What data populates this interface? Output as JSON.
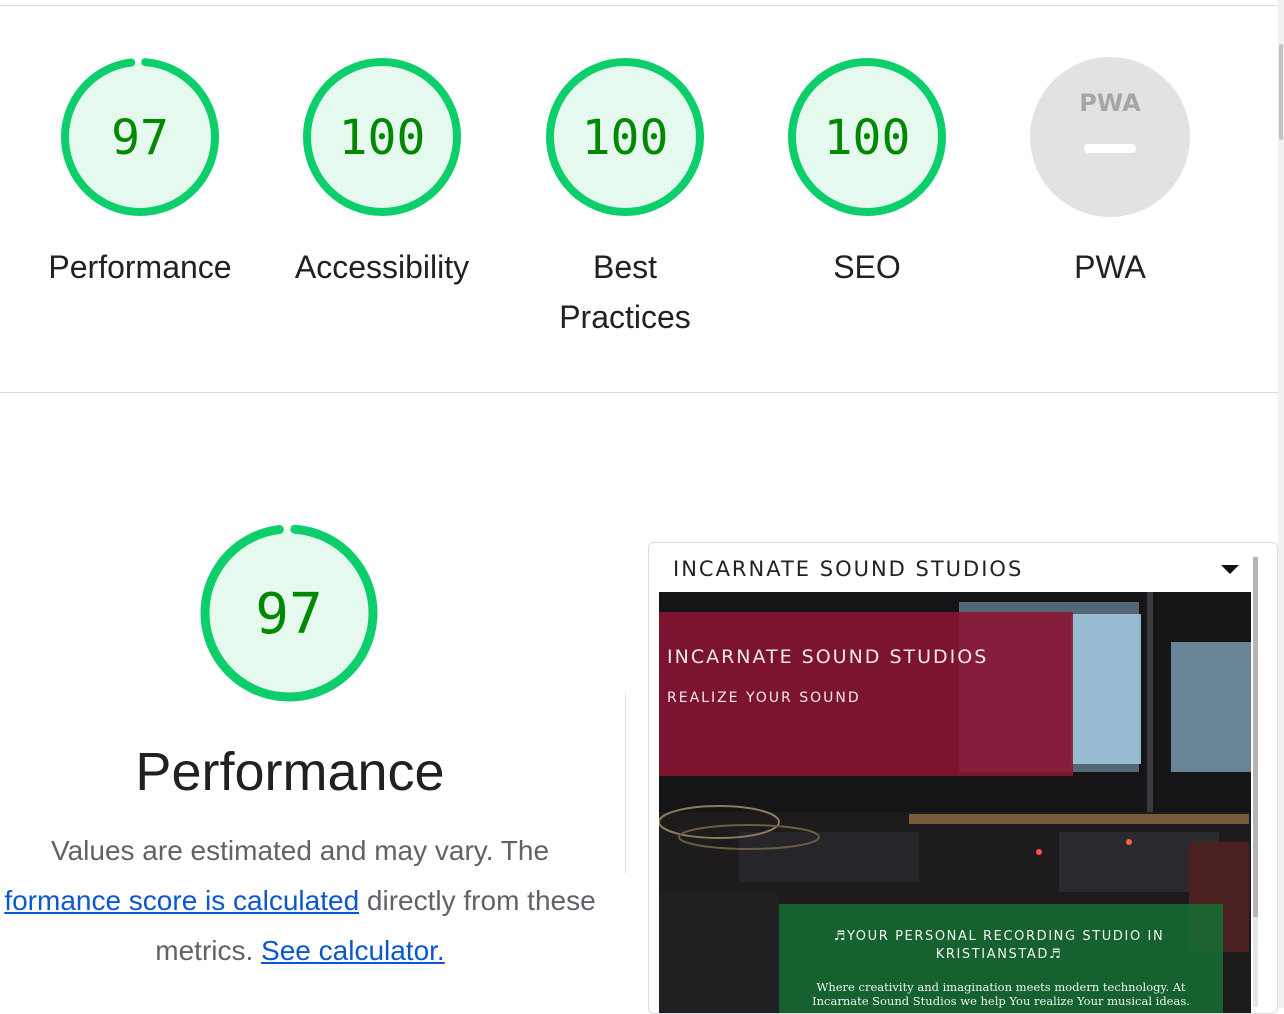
{
  "colors": {
    "pass_ring": "#0cce6b",
    "pass_fill": "#e5f9ee",
    "pass_text": "#008800",
    "na_fill": "#e2e2e2",
    "link": "#0b57d0"
  },
  "gauges": [
    {
      "label": "Performance",
      "score": "97",
      "fraction": 0.97
    },
    {
      "label": "Accessibility",
      "score": "100",
      "fraction": 1.0
    },
    {
      "label_line1": "Best",
      "label_line2": "Practices",
      "score": "100",
      "fraction": 1.0
    },
    {
      "label": "SEO",
      "score": "100",
      "fraction": 1.0
    },
    {
      "label": "PWA",
      "badge": "PWA",
      "score": "—"
    }
  ],
  "performance": {
    "score": "97",
    "fraction": 0.97,
    "title": "Performance",
    "desc_line1": "Values are estimated and may vary. The",
    "desc_link1": "formance score is calculated",
    "desc_after_link1": " directly from these",
    "desc_line3_prefix": "metrics.",
    "desc_link2": "See calculator."
  },
  "screenshot": {
    "site_title": "INCARNATE SOUND STUDIOS",
    "hero_title": "INCARNATE SOUND STUDIOS",
    "hero_subtitle": "REALIZE YOUR SOUND",
    "green_title": "♬YOUR PERSONAL RECORDING STUDIO IN KRISTIANSTAD♬",
    "green_text": "Where creativity and imagination meets modern technology. At Incarnate Sound Studios we help You realize Your musical ideas."
  }
}
